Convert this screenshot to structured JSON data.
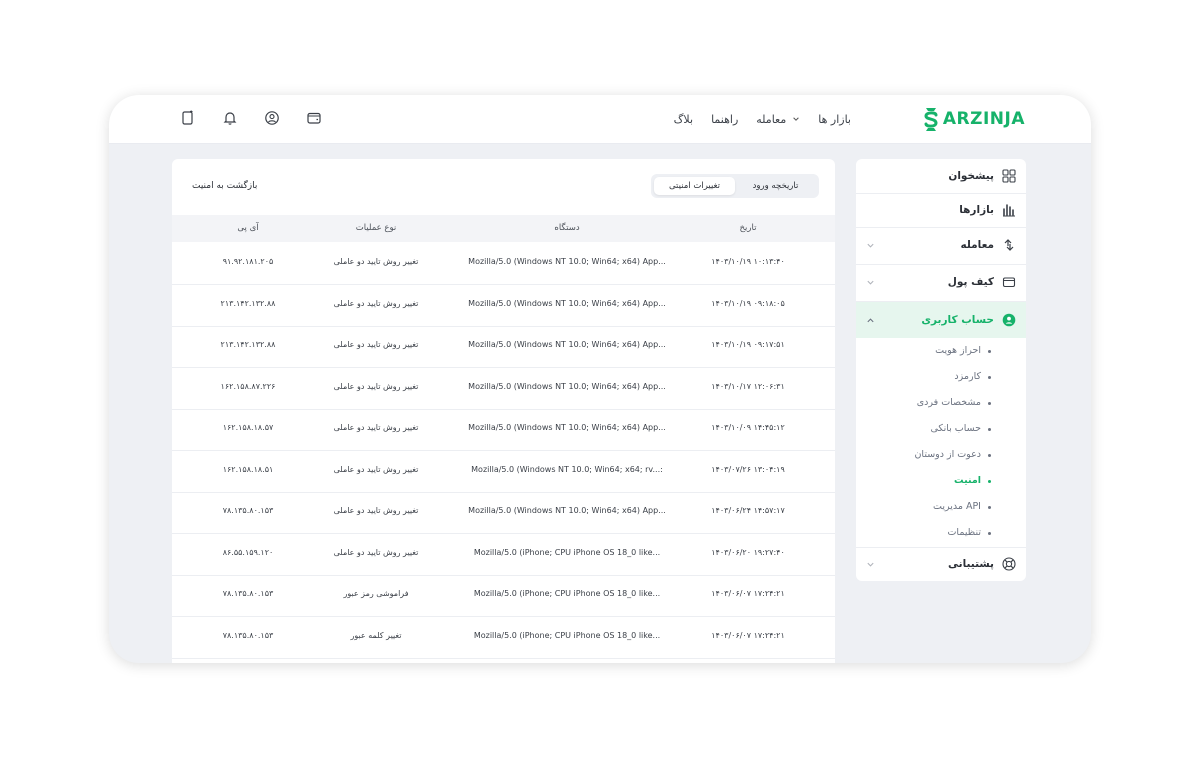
{
  "brand": {
    "name": "ARZINJA",
    "color": "#16b26a"
  },
  "topnav": {
    "items": [
      {
        "label": "بازار ها",
        "has_dropdown": false
      },
      {
        "label": "معامله",
        "has_dropdown": true
      },
      {
        "label": "راهنما",
        "has_dropdown": false
      },
      {
        "label": "بلاگ",
        "has_dropdown": false
      }
    ]
  },
  "topicons": [
    "exit-icon",
    "bell-icon",
    "user-icon",
    "wallet-icon"
  ],
  "sidebar": {
    "items": [
      {
        "label": "پیشخوان",
        "icon": "dashboard-icon",
        "chevron": "none"
      },
      {
        "label": "بازارها",
        "icon": "chart-icon",
        "chevron": "none"
      },
      {
        "label": "معامله",
        "icon": "exchange-icon",
        "chevron": "down"
      },
      {
        "label": "کیف پول",
        "icon": "wallet-icon",
        "chevron": "down"
      },
      {
        "label": "حساب کاربری",
        "icon": "user-icon",
        "chevron": "up",
        "active": true
      }
    ],
    "subitems": [
      {
        "label": "احراز هویت"
      },
      {
        "label": "کارمزد"
      },
      {
        "label": "مشخصات فردی"
      },
      {
        "label": "حساب بانکی"
      },
      {
        "label": "دعوت از دوستان"
      },
      {
        "label": "امنیت",
        "current": true
      },
      {
        "label": "مدیریت API"
      },
      {
        "label": "تنظیمات"
      }
    ],
    "support": {
      "label": "پشتیبانی",
      "icon": "support-icon"
    }
  },
  "main": {
    "back_label": "بازگشت به امنیت",
    "tabs": [
      {
        "label": "تاریخچه ورود",
        "selected": false
      },
      {
        "label": "تغییرات امنیتی",
        "selected": true
      }
    ],
    "table": {
      "headers": {
        "date": "تاریخ",
        "device": "دستگاه",
        "op": "نوع عملیات",
        "ip": "آی پی"
      },
      "rows": [
        {
          "date": "۱۴۰۳/۱۰/۱۹ ۱۰:۱۳:۴۰",
          "device": "Mozilla/5.0 (Windows NT 10.0; Win64; x64) App...",
          "op": "تغییر روش تایید دو عاملی",
          "ip": "۹۱.۹۲.۱۸۱.۲۰۵"
        },
        {
          "date": "۱۴۰۳/۱۰/۱۹ ۰۹:۱۸:۰۵",
          "device": "Mozilla/5.0 (Windows NT 10.0; Win64; x64) App...",
          "op": "تغییر روش تایید دو عاملی",
          "ip": "۲۱۳.۱۴۲.۱۳۲.۸۸"
        },
        {
          "date": "۱۴۰۳/۱۰/۱۹ ۰۹:۱۷:۵۱",
          "device": "Mozilla/5.0 (Windows NT 10.0; Win64; x64) App...",
          "op": "تغییر روش تایید دو عاملی",
          "ip": "۲۱۳.۱۴۲.۱۳۲.۸۸"
        },
        {
          "date": "۱۴۰۳/۱۰/۱۷ ۱۲:۰۶:۳۱",
          "device": "Mozilla/5.0 (Windows NT 10.0; Win64; x64) App...",
          "op": "تغییر روش تایید دو عاملی",
          "ip": "۱۶۲.۱۵۸.۸۷.۲۲۶"
        },
        {
          "date": "۱۴۰۳/۱۰/۰۹ ۱۴:۴۵:۱۲",
          "device": "Mozilla/5.0 (Windows NT 10.0; Win64; x64) App...",
          "op": "تغییر روش تایید دو عاملی",
          "ip": "۱۶۲.۱۵۸.۱۸.۵۷"
        },
        {
          "date": "۱۴۰۳/۰۷/۲۶ ۱۳:۰۴:۱۹",
          "device": "Mozilla/5.0 (Windows NT 10.0; Win64; x64; rv...:",
          "op": "تغییر روش تایید دو عاملی",
          "ip": "۱۶۲.۱۵۸.۱۸.۵۱"
        },
        {
          "date": "۱۴۰۳/۰۶/۲۴ ۱۴:۵۷:۱۷",
          "device": "Mozilla/5.0 (Windows NT 10.0; Win64; x64) App...",
          "op": "تغییر روش تایید دو عاملی",
          "ip": "۷۸.۱۳۵.۸۰.۱۵۳"
        },
        {
          "date": "۱۴۰۳/۰۶/۲۰ ۱۹:۲۷:۴۰",
          "device": "Mozilla/5.0 (iPhone; CPU iPhone OS 18_0 like...",
          "op": "تغییر روش تایید دو عاملی",
          "ip": "۸۶.۵۵.۱۵۹.۱۲۰"
        },
        {
          "date": "۱۴۰۳/۰۶/۰۷ ۱۷:۲۴:۲۱",
          "device": "Mozilla/5.0 (iPhone; CPU iPhone OS 18_0 like...",
          "op": "فراموشی رمز عبور",
          "ip": "۷۸.۱۳۵.۸۰.۱۵۳"
        },
        {
          "date": "۱۴۰۳/۰۶/۰۷ ۱۷:۲۴:۲۱",
          "device": "Mozilla/5.0 (iPhone; CPU iPhone OS 18_0 like...",
          "op": "تغییر کلمه عبور",
          "ip": "۷۸.۱۳۵.۸۰.۱۵۳"
        }
      ]
    }
  }
}
